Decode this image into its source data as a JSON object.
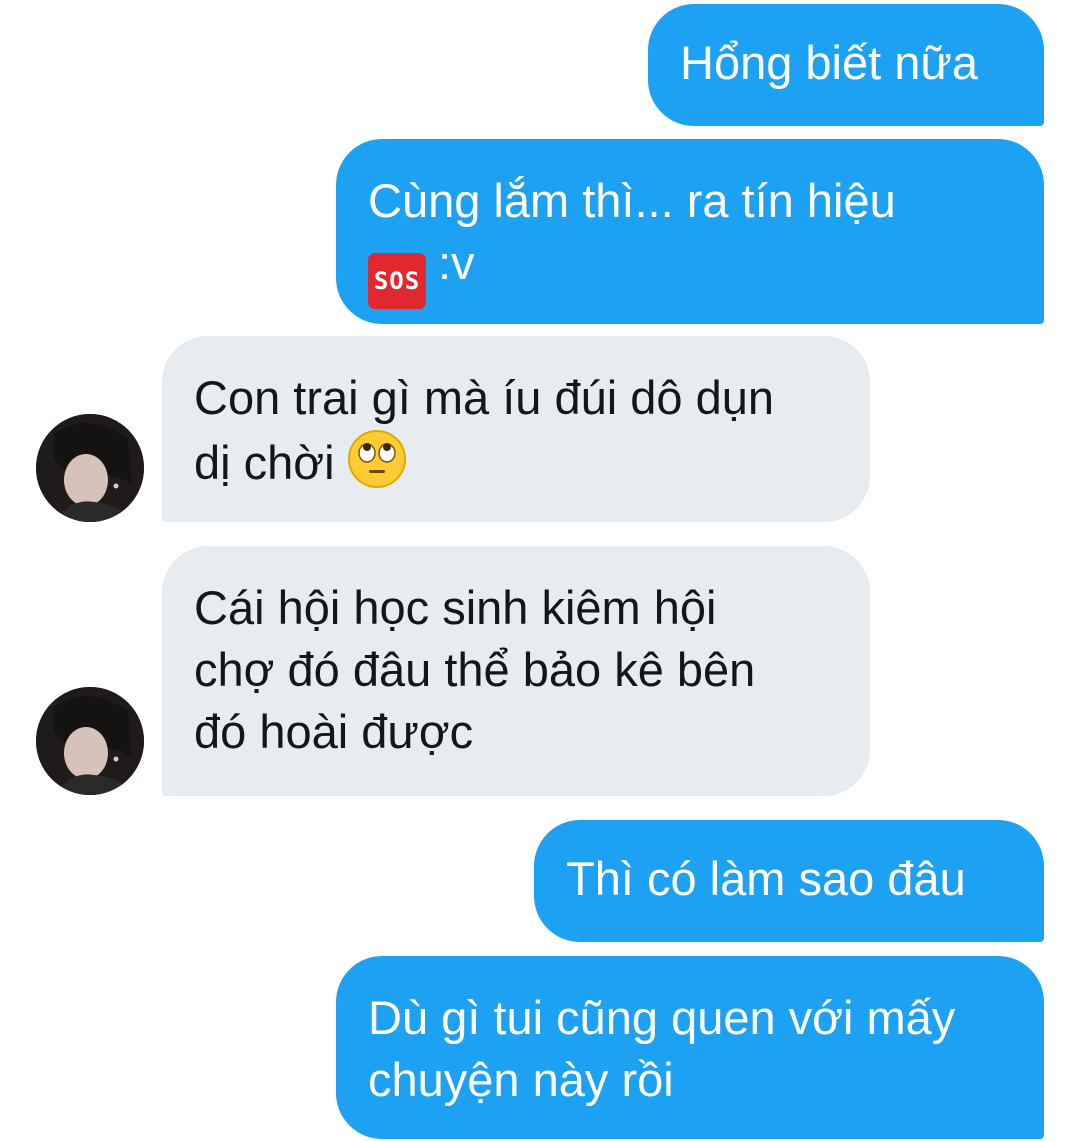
{
  "messages": [
    {
      "side": "out",
      "lines": [
        "Hổng biết nữa"
      ]
    },
    {
      "side": "out",
      "lines": [
        "Cùng lắm thì... ra tín hiệu",
        ":v"
      ],
      "icon": "sos-icon",
      "icon_text": "SOS"
    },
    {
      "side": "in",
      "lines": [
        "Con trai gì mà íu đúi dô dụn",
        "dị chời"
      ],
      "icon": "face-with-rolling-eyes-icon"
    },
    {
      "side": "in",
      "lines": [
        "Cái hội học sinh kiêm hội",
        "chợ đó đâu thể bảo kê bên",
        "đó hoài được"
      ]
    },
    {
      "side": "out",
      "lines": [
        "Thì có làm sao đâu"
      ]
    },
    {
      "side": "out",
      "lines": [
        "Dù gì tui cũng quen với mấy",
        "chuyện này rồi"
      ]
    }
  ],
  "colors": {
    "outgoing_bubble": "#1da1f2",
    "incoming_bubble": "#e6ecf0",
    "outgoing_text": "#ffffff",
    "incoming_text": "#14171a",
    "sos_badge": "#e0282e"
  }
}
